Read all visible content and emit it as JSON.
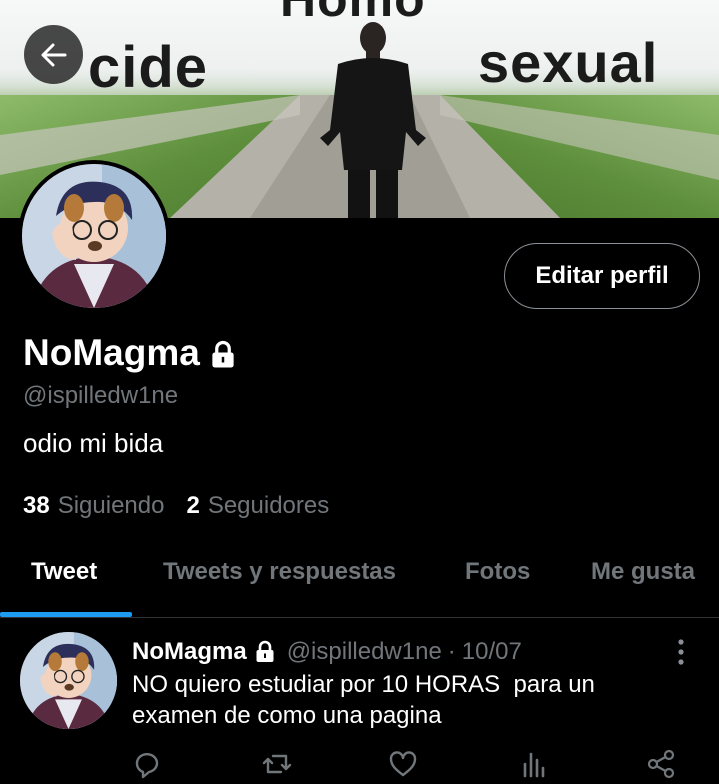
{
  "banner": {
    "word_top": "Homo",
    "word_left": "cide",
    "word_right": "sexual"
  },
  "profile": {
    "display_name": "NoMagma",
    "handle": "@ispilledw1ne",
    "bio": "odio mi bida",
    "edit_button": "Editar perfil",
    "following_count": "38",
    "following_label": "Siguiendo",
    "followers_count": "2",
    "followers_label": "Seguidores"
  },
  "tabs": [
    {
      "label": "Tweet",
      "active": true
    },
    {
      "label": "Tweets y respuestas",
      "active": false
    },
    {
      "label": "Fotos",
      "active": false
    },
    {
      "label": "Me gusta",
      "active": false
    }
  ],
  "tweet": {
    "name": "NoMagma",
    "handle": "@ispilledw1ne",
    "separator": "·",
    "date": "10/07",
    "text": "NO quiero estudiar por 10 HORAS  para un\nexamen de como una pagina"
  },
  "icons": {
    "back": "arrow-left-icon",
    "lock": "lock-icon",
    "more": "more-vertical-icon",
    "reply": "reply-icon",
    "retweet": "retweet-icon",
    "like": "heart-icon",
    "stats": "stats-icon",
    "share": "share-icon"
  },
  "colors": {
    "background": "#000000",
    "accent": "#1d9bf0",
    "muted": "#71767b",
    "text": "#ffffff"
  }
}
